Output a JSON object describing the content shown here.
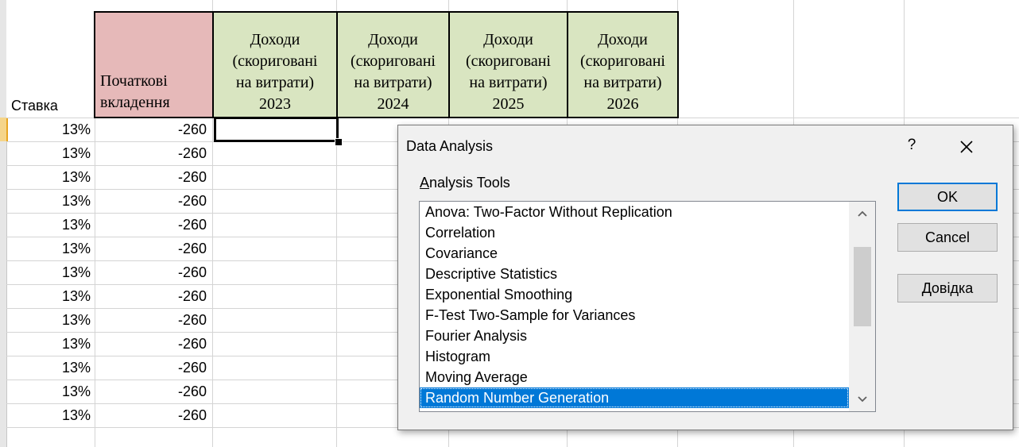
{
  "spreadsheet": {
    "headers": {
      "rate": "Ставка",
      "initial_investment_line1": "Початкові",
      "initial_investment_line2": "вкладення",
      "income_line1": "Доходи",
      "income_line2": "(скоригованi",
      "income_line3": "на витрати)",
      "years": [
        "2023",
        "2024",
        "2025",
        "2026"
      ]
    },
    "rows": [
      {
        "rate": "13%",
        "investment": "-260"
      },
      {
        "rate": "13%",
        "investment": "-260"
      },
      {
        "rate": "13%",
        "investment": "-260"
      },
      {
        "rate": "13%",
        "investment": "-260"
      },
      {
        "rate": "13%",
        "investment": "-260"
      },
      {
        "rate": "13%",
        "investment": "-260"
      },
      {
        "rate": "13%",
        "investment": "-260"
      },
      {
        "rate": "13%",
        "investment": "-260"
      },
      {
        "rate": "13%",
        "investment": "-260"
      },
      {
        "rate": "13%",
        "investment": "-260"
      },
      {
        "rate": "13%",
        "investment": "-260"
      },
      {
        "rate": "13%",
        "investment": "-260"
      },
      {
        "rate": "13%",
        "investment": "-260"
      }
    ],
    "colors": {
      "header_green": "#d9e5c1",
      "header_pink": "#e6b9b9"
    }
  },
  "dialog": {
    "title": "Data Analysis",
    "help_glyph": "?",
    "close_icon": "close-icon",
    "label_prefix": "A",
    "label_rest": "nalysis Tools",
    "tools": [
      "Anova: Two-Factor Without Replication",
      "Correlation",
      "Covariance",
      "Descriptive Statistics",
      "Exponential Smoothing",
      "F-Test Two-Sample for Variances",
      "Fourier Analysis",
      "Histogram",
      "Moving Average",
      "Random Number Generation"
    ],
    "selected_tool": "Random Number Generation",
    "buttons": {
      "ok": "OK",
      "cancel": "Cancel",
      "help_prefix": "Д",
      "help_rest": "овідка"
    },
    "accent": "#0078d7"
  }
}
